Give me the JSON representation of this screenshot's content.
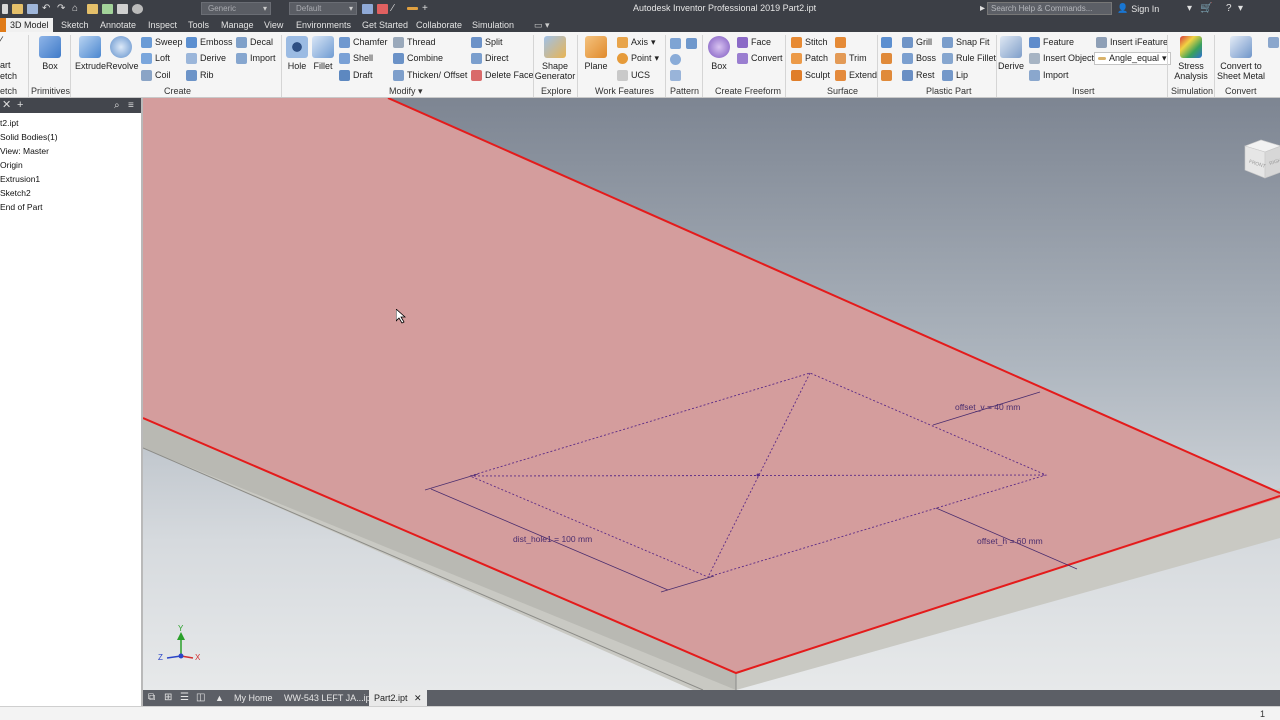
{
  "titlebar": {
    "appearance_value": "Generic",
    "material_value": "Default",
    "title": "Autodesk Inventor Professional 2019    Part2.ipt",
    "search_placeholder": "Search Help & Commands...",
    "sign_in": "Sign In"
  },
  "tabs": [
    "3D Model",
    "Sketch",
    "Annotate",
    "Inspect",
    "Tools",
    "Manage",
    "View",
    "Environments",
    "Get Started",
    "Collaborate",
    "Simulation"
  ],
  "ribbon": {
    "sketch_cut_top": "art",
    "sketch_cut_mid": "etch",
    "sketch_cut_label": "etch",
    "primitives": {
      "box": "Box",
      "label": "Primitives"
    },
    "create": {
      "extrude": "Extrude",
      "revolve": "Revolve",
      "sweep": "Sweep",
      "emboss": "Emboss",
      "decal": "Decal",
      "loft": "Loft",
      "derive": "Derive",
      "import": "Import",
      "coil": "Coil",
      "rib": "Rib",
      "label": "Create"
    },
    "modify": {
      "hole": "Hole",
      "fillet": "Fillet",
      "chamfer": "Chamfer",
      "thread": "Thread",
      "split": "Split",
      "shell": "Shell",
      "combine": "Combine",
      "direct": "Direct",
      "draft": "Draft",
      "thicken_offset": "Thicken/ Offset",
      "delete_face": "Delete Face",
      "label": "Modify ▾"
    },
    "explore": {
      "shape_generator_1": "Shape",
      "shape_generator_2": "Generator",
      "label": "Explore"
    },
    "work_features": {
      "plane": "Plane",
      "axis": "Axis",
      "point": "Point",
      "ucs": "UCS",
      "label": "Work Features"
    },
    "pattern": {
      "label": "Pattern"
    },
    "freeform": {
      "box": "Box",
      "face": "Face",
      "convert": "Convert",
      "label": "Create Freeform"
    },
    "surface": {
      "stitch": "Stitch",
      "patch": "Patch",
      "trim": "Trim",
      "sculpt": "Sculpt",
      "extend": "Extend",
      "label": "Surface"
    },
    "plastic_part": {
      "grill": "Grill",
      "snap_fit": "Snap Fit",
      "boss": "Boss",
      "rule_fillet": "Rule Fillet",
      "rest": "Rest",
      "lip": "Lip",
      "label": "Plastic Part"
    },
    "insert": {
      "derive": "Derive",
      "feature": "Feature",
      "insert_ifeature": "Insert iFeature",
      "insert_object": "Insert Object",
      "angle_equal": "Angle_equal",
      "import": "Import",
      "label": "Insert"
    },
    "simulation": {
      "stress_1": "Stress",
      "stress_2": "Analysis",
      "label": "Simulation"
    },
    "convert": {
      "sheet_1": "Convert to",
      "sheet_2": "Sheet Metal",
      "label": "Convert"
    }
  },
  "browser": {
    "items": [
      "t2.ipt",
      "Solid Bodies(1)",
      "View: Master",
      "Origin",
      "Extrusion1",
      "Sketch2",
      "End of Part"
    ]
  },
  "viewport": {
    "dims": {
      "offset_v": "offset_v = 40 mm",
      "dist_hole1": "dist_hole1 = 100 mm",
      "offset_h": "offset_h = 60 mm"
    },
    "viewcube": {
      "front": "FRONT",
      "right": "RIGH"
    },
    "axis": {
      "x": "X",
      "y": "Y",
      "z": "Z"
    }
  },
  "doctabs": {
    "my_home": "My Home",
    "file1": "WW-543 LEFT JA...ipt",
    "file2": "Part2.ipt"
  },
  "status": {
    "count": "1"
  },
  "colors": {
    "plate_top": "#d49d9d",
    "plate_edge": "#e41b1b",
    "plate_side": "#c9c9c3",
    "sketch": "#5b2a86",
    "chrome_dark": "#3c3f46"
  }
}
